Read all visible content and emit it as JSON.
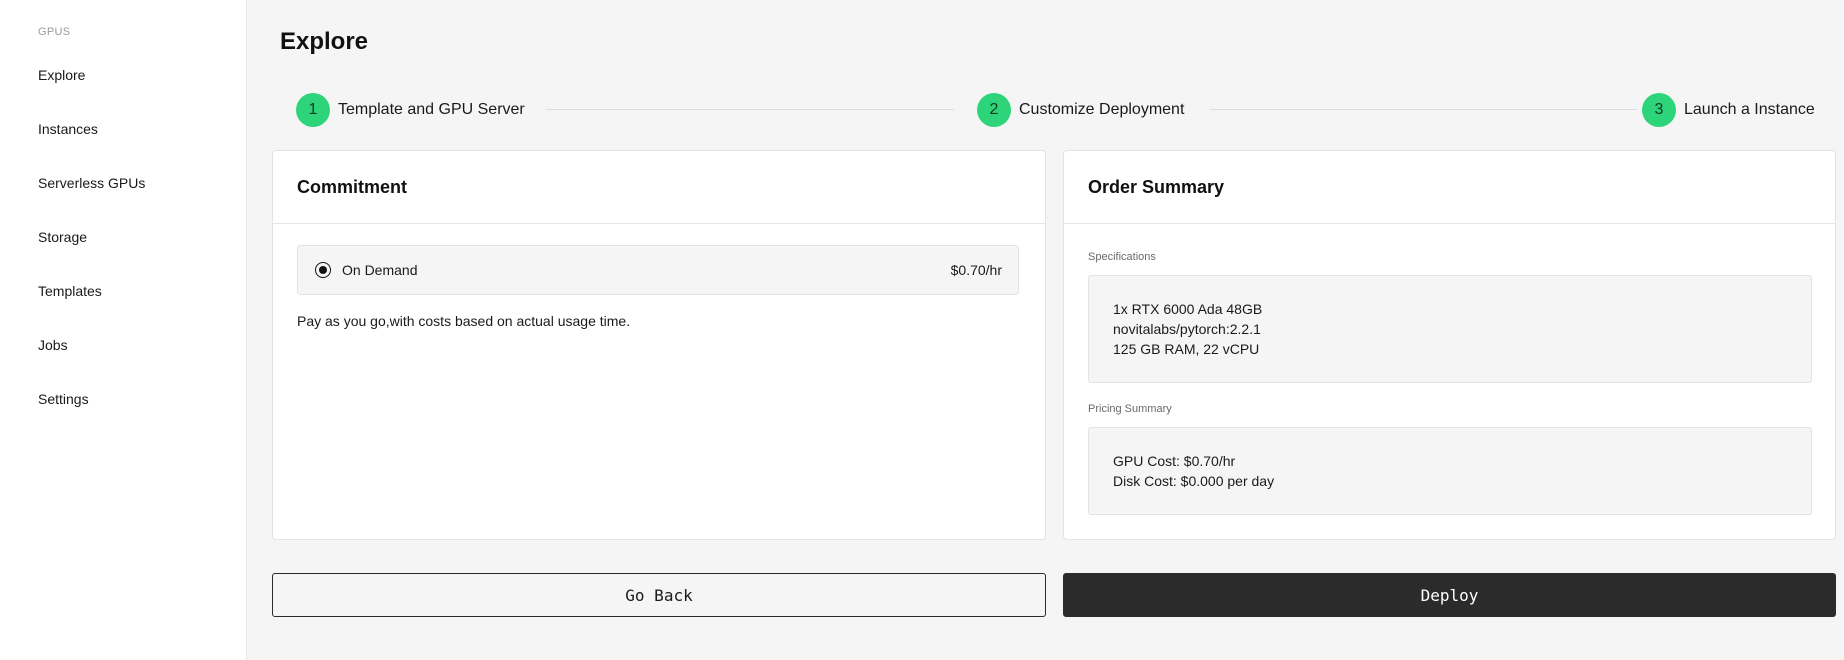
{
  "sidebar": {
    "section_label": "GPUS",
    "items": [
      {
        "label": "Explore"
      },
      {
        "label": "Instances"
      },
      {
        "label": "Serverless GPUs"
      },
      {
        "label": "Storage"
      },
      {
        "label": "Templates"
      },
      {
        "label": "Jobs"
      },
      {
        "label": "Settings"
      }
    ]
  },
  "page": {
    "title": "Explore"
  },
  "stepper": {
    "steps": [
      {
        "number": "1",
        "label": "Template and GPU Server"
      },
      {
        "number": "2",
        "label": "Customize Deployment"
      },
      {
        "number": "3",
        "label": "Launch a Instance"
      }
    ],
    "accent_color": "#2ed47a"
  },
  "commitment": {
    "title": "Commitment",
    "option": {
      "label": "On Demand",
      "price": "$0.70/hr",
      "selected": true
    },
    "description": "Pay as you go,with costs based on actual usage time."
  },
  "order_summary": {
    "title": "Order Summary",
    "specifications_label": "Specifications",
    "specifications": [
      "1x RTX 6000 Ada 48GB",
      "novitalabs/pytorch:2.2.1",
      "125 GB RAM, 22 vCPU"
    ],
    "pricing_label": "Pricing Summary",
    "pricing": [
      "GPU Cost: $0.70/hr",
      "Disk Cost: $0.000 per day"
    ]
  },
  "actions": {
    "back_label": "Go Back",
    "deploy_label": "Deploy"
  }
}
